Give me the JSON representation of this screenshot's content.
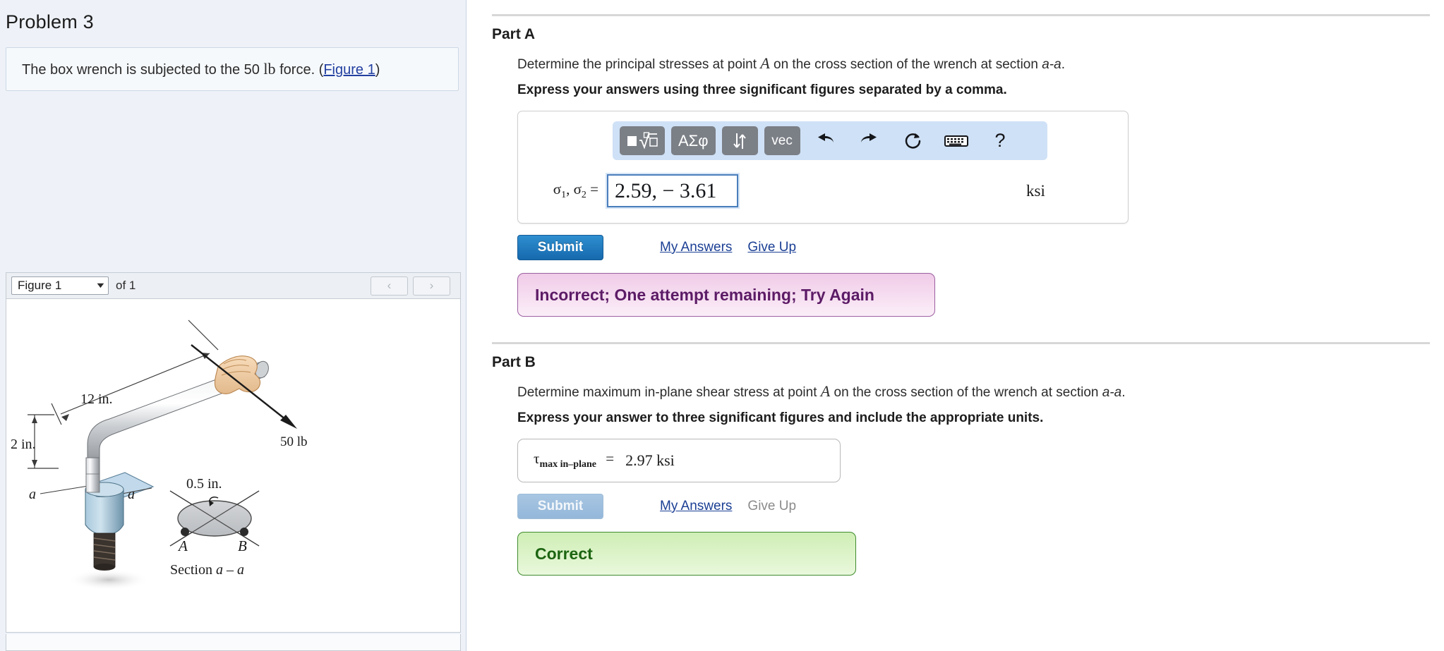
{
  "left": {
    "problem_title": "Problem 3",
    "statement_pre": "The box wrench is subjected to the 50 ",
    "statement_unit": "lb",
    "statement_post": " force. (",
    "figure_link": "Figure 1",
    "statement_close": ")",
    "figure_selected": "Figure 1",
    "figure_count_label": "of 1",
    "nav_prev": "‹",
    "nav_next": "›"
  },
  "figure": {
    "labels": {
      "len_12": "12 in.",
      "len_2": "2 in.",
      "force": "50 lb",
      "dia": "0.5 in.",
      "sec_left": "a",
      "sec_right": "a",
      "point_a": "A",
      "point_b": "B",
      "section_caption_pre": "Section ",
      "section_caption_a1": "a",
      "section_caption_dash": " – ",
      "section_caption_a2": "a"
    }
  },
  "partA": {
    "heading": "Part A",
    "question_pre": "Determine the principal stresses at point ",
    "question_var": "A",
    "question_mid": " on the cross section of the wrench at section ",
    "question_sec": "a-a",
    "question_end": ".",
    "instruction": "Express your answers using three significant figures separated by a comma.",
    "toolbar": {
      "templates": "■",
      "greek": "ΑΣφ",
      "arrows": "↓↑",
      "vec": "vec",
      "undo": "undo-arrow",
      "redo": "redo-arrow",
      "reset": "reset-arrow",
      "keyboard": "keyboard",
      "help": "?"
    },
    "answer_label_sigma": "σ",
    "answer_sub_1": "1",
    "answer_sub_2": "2",
    "answer_label_eq": "=",
    "answer_value": "2.59, − 3.61",
    "unit": "ksi",
    "submit_label": "Submit",
    "my_answers_label": "My Answers",
    "give_up_label": "Give Up",
    "feedback": "Incorrect; One attempt remaining; Try Again"
  },
  "partB": {
    "heading": "Part B",
    "question_pre": "Determine maximum in-plane shear stress at point ",
    "question_var": "A",
    "question_mid": " on the cross section of the wrench at section ",
    "question_sec": "a-a",
    "question_end": ".",
    "instruction": "Express your answer to three significant figures and include the appropriate units.",
    "answer_label_tau": "τ",
    "answer_label_sub": "max in–plane",
    "answer_label_eq": "=",
    "answer_value": "2.97 ksi",
    "submit_label": "Submit",
    "my_answers_label": "My Answers",
    "give_up_label": "Give Up",
    "feedback": "Correct"
  },
  "colors": {
    "accent_blue": "#1669ad",
    "link_blue": "#1b3f94",
    "incorrect_border": "#9b5fa0",
    "incorrect_text": "#5c1b66",
    "correct_border": "#3f8b2e",
    "correct_text": "#1d6512",
    "panel_bg": "#eef2f8"
  }
}
